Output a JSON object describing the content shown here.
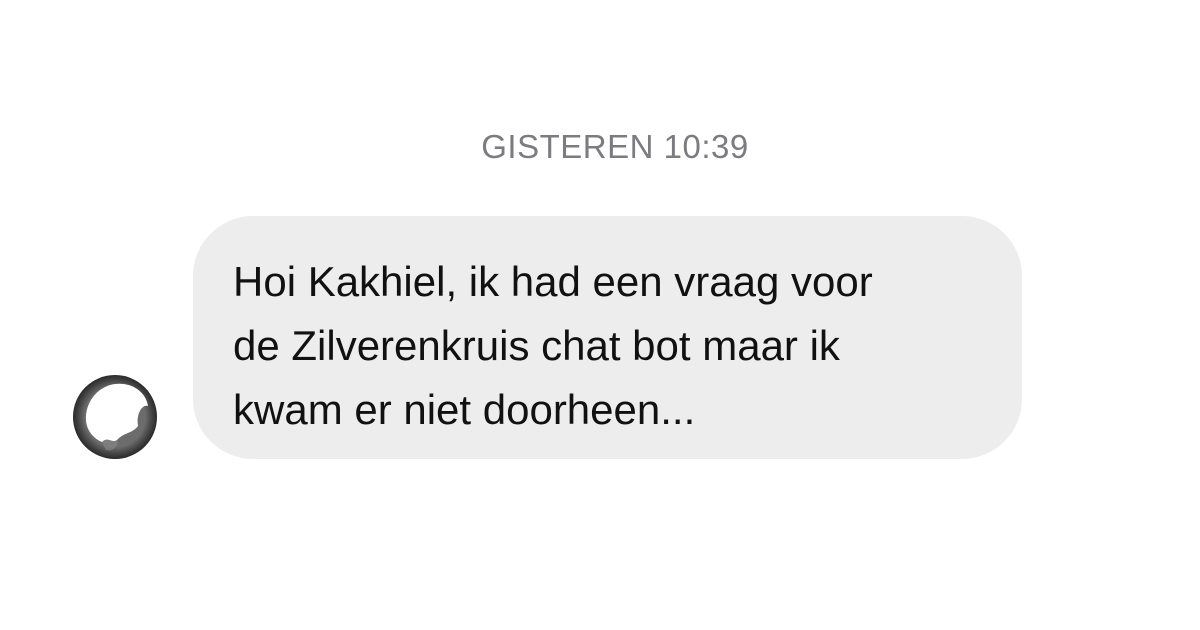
{
  "conversation": {
    "timestamp": "GISTEREN 10:39",
    "message": {
      "lines": [
        "Hoi Kakhiel, ik had een vraag voor",
        "de Zilverenkruis chat bot maar ik",
        "kwam er niet doorheen..."
      ]
    }
  },
  "colors": {
    "background": "#ffffff",
    "bubble": "#ededed",
    "timestamp_text": "#7b7b80",
    "message_text": "#111111"
  }
}
